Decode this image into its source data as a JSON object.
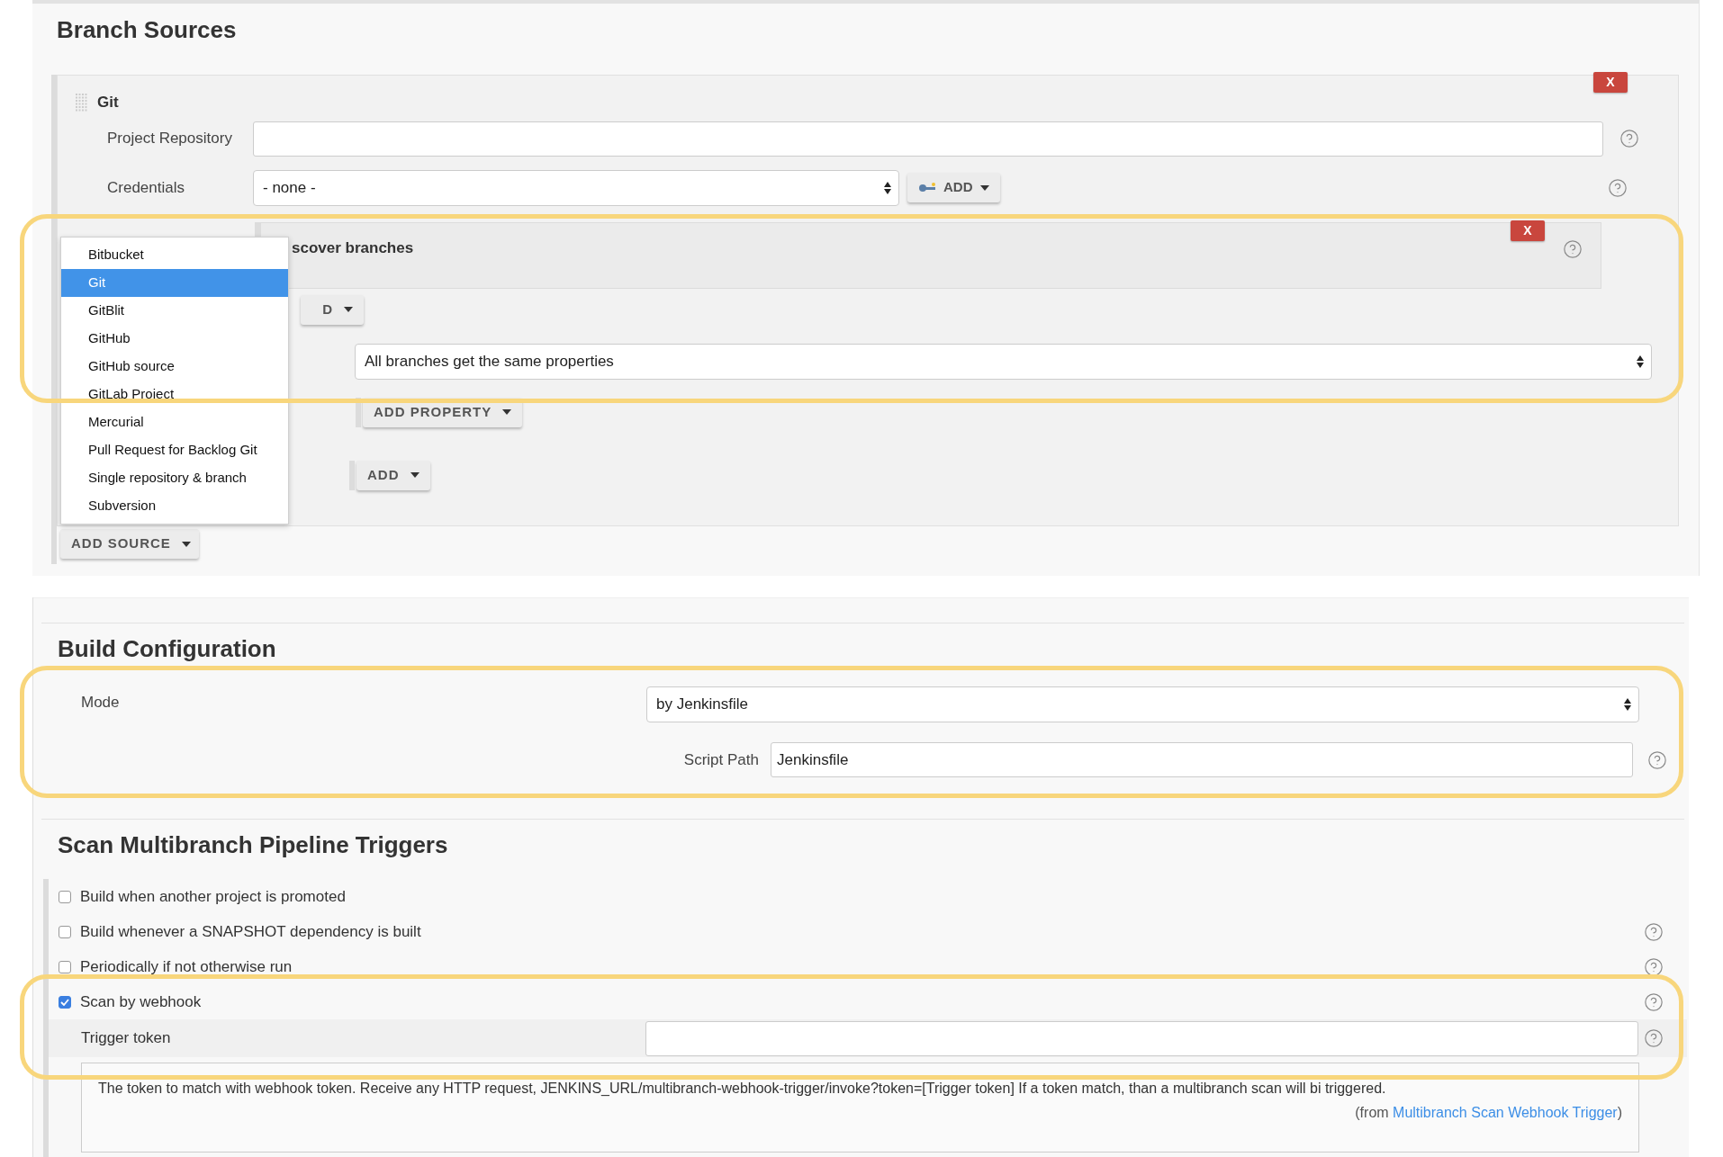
{
  "branch_sources": {
    "heading": "Branch Sources",
    "git_source": {
      "title": "Git",
      "remove_button": "X",
      "project_repository": {
        "label": "Project Repository"
      },
      "credentials": {
        "label": "Credentials",
        "value": "- none -",
        "add_button": "ADD"
      },
      "behaviour": {
        "title": "scover branches",
        "remove_button": "X"
      },
      "behaviour_add_button": "D",
      "property_strategy": {
        "value": "All branches get the same properties"
      },
      "add_property_button": "ADD PROPERTY",
      "add_button": "ADD"
    },
    "add_source_button": "ADD SOURCE",
    "source_menu": [
      {
        "label": "Bitbucket",
        "selected": false
      },
      {
        "label": "Git",
        "selected": true
      },
      {
        "label": "GitBlit",
        "selected": false
      },
      {
        "label": "GitHub",
        "selected": false
      },
      {
        "label": "GitHub source",
        "selected": false
      },
      {
        "label": "GitLab Project",
        "selected": false
      },
      {
        "label": "Mercurial",
        "selected": false
      },
      {
        "label": "Pull Request for Backlog Git",
        "selected": false
      },
      {
        "label": "Single repository & branch",
        "selected": false
      },
      {
        "label": "Subversion",
        "selected": false
      }
    ]
  },
  "build_configuration": {
    "heading": "Build Configuration",
    "mode": {
      "label": "Mode",
      "value": "by Jenkinsfile"
    },
    "script_path": {
      "label": "Script Path",
      "value": "Jenkinsfile"
    }
  },
  "triggers": {
    "heading": "Scan Multibranch Pipeline Triggers",
    "options": [
      {
        "label": "Build when another project is promoted",
        "checked": false,
        "has_help": false
      },
      {
        "label": "Build whenever a SNAPSHOT dependency is built",
        "checked": false,
        "has_help": true
      },
      {
        "label": "Periodically if not otherwise run",
        "checked": false,
        "has_help": true
      },
      {
        "label": "Scan by webhook",
        "checked": true,
        "has_help": true
      }
    ],
    "trigger_token": {
      "label": "Trigger token"
    },
    "help_text": "The token to match with webhook token. Receive any HTTP request, JENKINS_URL/multibranch-webhook-trigger/invoke?token=[Trigger token] If a token match, than a multibranch scan will bi triggered.",
    "help_source": {
      "prefix": "(from",
      "link": "Multibranch Scan Webhook Trigger",
      "suffix": ")"
    }
  }
}
